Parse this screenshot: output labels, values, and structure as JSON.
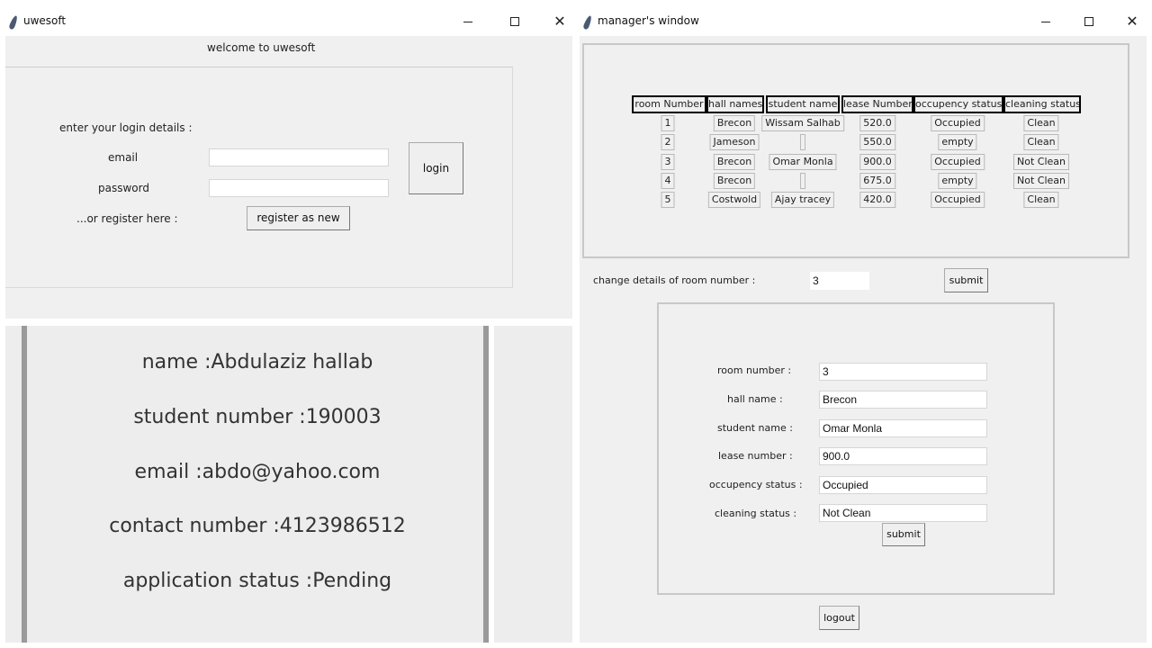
{
  "login_window": {
    "title": "uwesoft",
    "welcome": "welcome to uwesoft",
    "prompt": "enter your login details :",
    "email_label": "email",
    "email_value": "",
    "password_label": "password",
    "password_value": "",
    "login_button": "login",
    "register_prompt": "...or register here :",
    "register_button": "register as new"
  },
  "student_panel": {
    "name": "name :Abdulaziz hallab",
    "student_number": "student number :190003",
    "email": "email :abdo@yahoo.com",
    "contact_number": "contact number :4123986512",
    "application_status": "application status  :Pending"
  },
  "manager_window": {
    "title": "manager's window",
    "table": {
      "headers": [
        "room Number",
        "hall names",
        "student name",
        "lease Number",
        "occupency status",
        "cleaning status"
      ],
      "rows": [
        [
          "1",
          "Brecon",
          "Wissam Salhab",
          "520.0",
          "Occupied",
          "Clean"
        ],
        [
          "2",
          "Jameson",
          "",
          "550.0",
          "empty",
          "Clean"
        ],
        [
          "3",
          "Brecon",
          "Omar Monla",
          "900.0",
          "Occupied",
          "Not Clean"
        ],
        [
          "4",
          "Brecon",
          "",
          "675.0",
          "empty",
          "Not Clean"
        ],
        [
          "5",
          "Costwold",
          "Ajay tracey",
          "420.0",
          "Occupied",
          "Clean"
        ]
      ]
    },
    "change_label": "change details of room number :",
    "change_value": "3",
    "submit_top": "submit",
    "form": {
      "room_number_label": "room number :",
      "room_number_value": "3",
      "hall_name_label": "hall name :",
      "hall_name_value": "Brecon",
      "student_name_label": "student name :",
      "student_name_value": "Omar Monla",
      "lease_number_label": "lease number :",
      "lease_number_value": "900.0",
      "occupency_label": "occupency status :",
      "occupency_value": "Occupied",
      "cleaning_label": "cleaning status :",
      "cleaning_value": "Not Clean",
      "submit": "submit"
    },
    "logout": "logout"
  },
  "titlebar_controls": {
    "minimize": "",
    "maximize": "",
    "close": "✕"
  }
}
